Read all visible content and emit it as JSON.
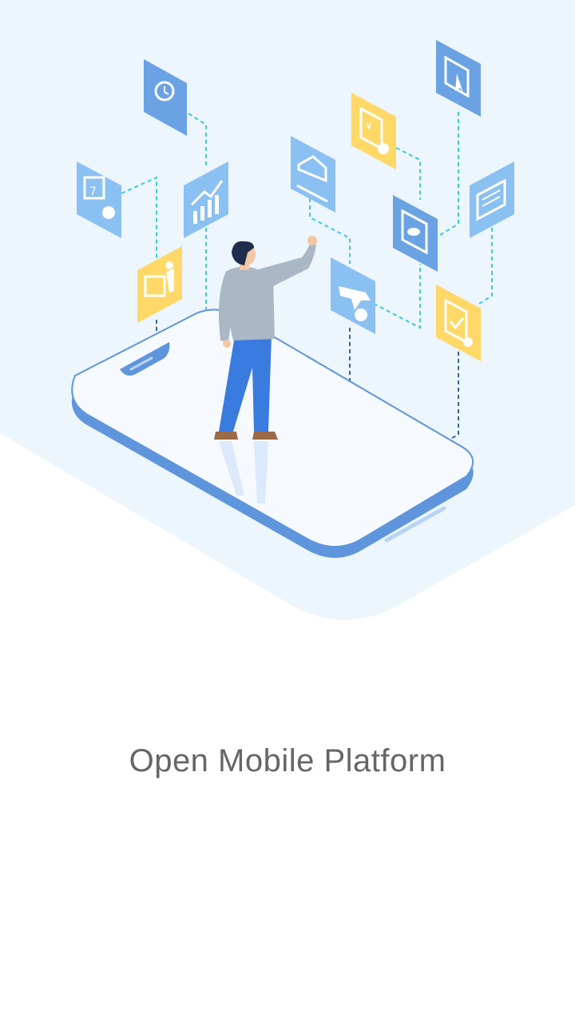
{
  "splash": {
    "tagline": "Open Mobile Platform"
  },
  "colors": {
    "background": "#ffffff",
    "backdrop": "#edf5fd",
    "phone_frame": "#5f95dc",
    "phone_screen": "#f6faff",
    "icon_blue": "#8bc0f2",
    "icon_blue_dark": "#6aa2e4",
    "icon_yellow": "#ffd867",
    "connector_cyan": "#36cde0",
    "connector_navy": "#2f66b3",
    "tagline_text": "#666666"
  },
  "icons": [
    "location-time-icon",
    "calendar-icon",
    "chart-growth-icon",
    "presentation-icon",
    "car-icon",
    "finance-document-icon",
    "bookmark-icon",
    "cloud-storage-icon",
    "news-icon",
    "flight-icon",
    "approval-document-icon"
  ]
}
